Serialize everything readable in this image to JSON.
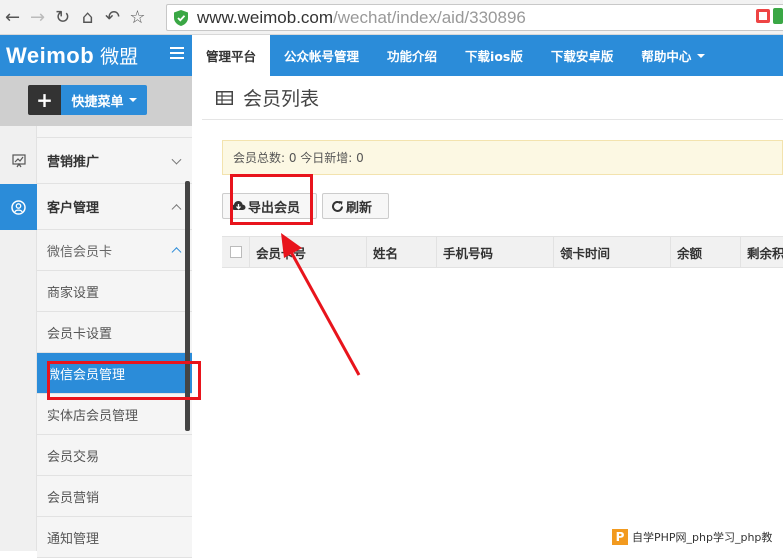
{
  "browser": {
    "url_host": "www.weimob.com",
    "url_path": "/wechat/index/aid/330896"
  },
  "brand": {
    "name": "Weimob",
    "name_cn": "微盟"
  },
  "quick_menu": {
    "label": "快捷菜单"
  },
  "topnav": {
    "items": [
      {
        "label": "管理平台"
      },
      {
        "label": "公众帐号管理"
      },
      {
        "label": "功能介绍"
      },
      {
        "label": "下载ios版"
      },
      {
        "label": "下载安卓版"
      },
      {
        "label": "帮助中心"
      }
    ]
  },
  "sidebar": {
    "groups": [
      {
        "label": "营销推广"
      },
      {
        "label": "客户管理"
      }
    ],
    "sub_header": "微信会员卡",
    "items": [
      {
        "label": "商家设置"
      },
      {
        "label": "会员卡设置"
      },
      {
        "label": "微信会员管理"
      },
      {
        "label": "实体店会员管理"
      },
      {
        "label": "会员交易"
      },
      {
        "label": "会员营销"
      },
      {
        "label": "通知管理"
      }
    ]
  },
  "page": {
    "title": "会员列表",
    "stats": "会员总数: 0 今日新增: 0",
    "export_label": "导出会员",
    "refresh_label": "刷新"
  },
  "table": {
    "columns": [
      "会员卡号",
      "姓名",
      "手机号码",
      "领卡时间",
      "余额",
      "剩余积"
    ]
  },
  "watermark": {
    "logo": "P",
    "text": "自学PHP网_php学习_php教"
  },
  "colors": {
    "brand_blue": "#2b8cd9",
    "annotation_red": "#e8141c",
    "alert_bg": "#fcf8e3"
  }
}
